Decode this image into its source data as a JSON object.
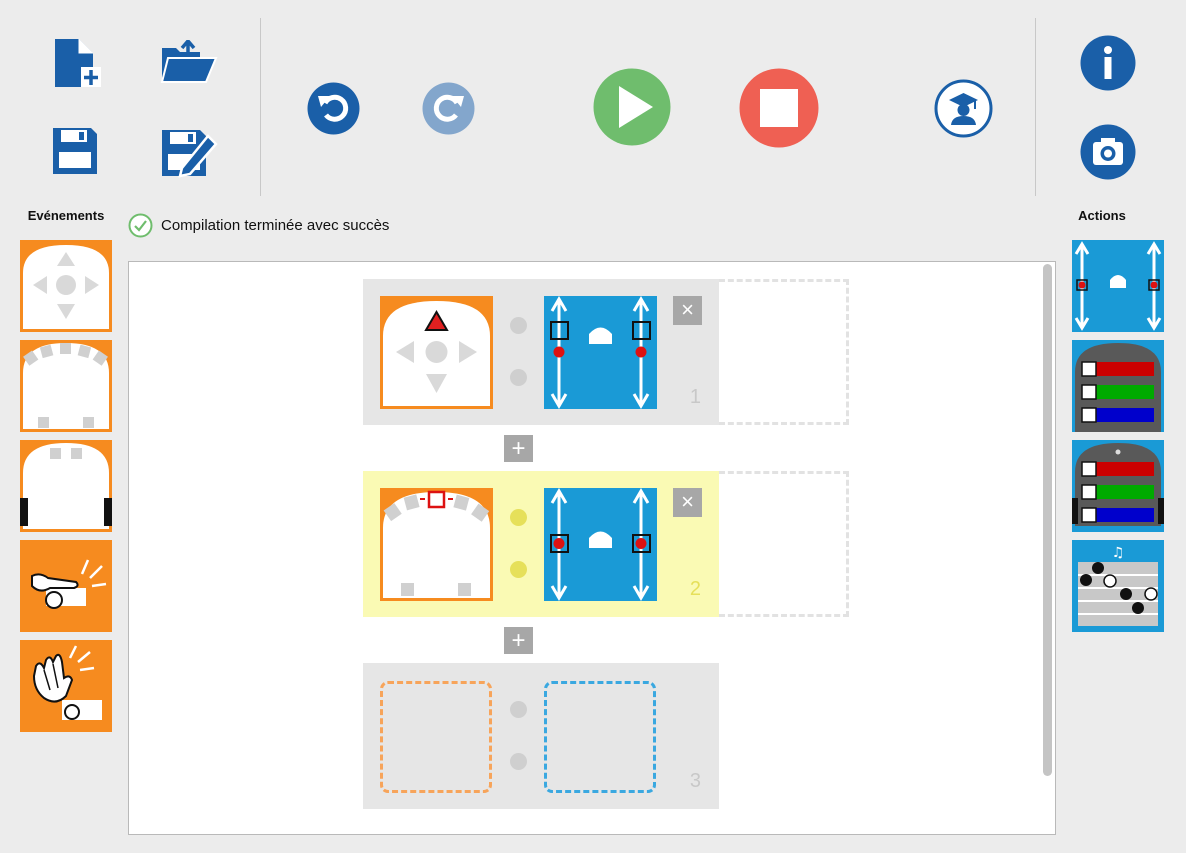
{
  "toolbar": {
    "new": "file-new-icon",
    "open": "folder-open-icon",
    "save": "save-icon",
    "save_as": "save-as-icon",
    "undo": "undo-icon",
    "redo": "redo-icon",
    "run": "play-icon",
    "stop": "stop-icon",
    "advanced": "graduate-icon",
    "info": "info-icon",
    "screenshot": "camera-icon"
  },
  "colors": {
    "brand_blue": "#1a5fa8",
    "redo_blue": "#83a6cc",
    "play_green": "#6fbd6d",
    "stop_red": "#ef6053",
    "event_orange": "#f68b1f",
    "action_blue": "#1a9ad6",
    "pair_yellow": "#fafab4"
  },
  "left_panel": {
    "title": "Evénements",
    "tiles": [
      "buttons-event",
      "prox-horizontal-event",
      "prox-ground-event",
      "tap-event",
      "clap-event"
    ]
  },
  "right_panel": {
    "title": "Actions",
    "tiles": [
      "motors-action",
      "top-color-action",
      "bottom-color-action",
      "music-action"
    ]
  },
  "status": {
    "text": "Compilation terminée avec succès",
    "state": "success"
  },
  "pairs": [
    {
      "number": "1",
      "event": "buttons",
      "action": "motors",
      "highlighted": false
    },
    {
      "number": "2",
      "event": "prox-horizontal",
      "action": "motors",
      "highlighted": true
    },
    {
      "number": "3",
      "event": "empty",
      "action": "empty",
      "highlighted": false
    }
  ],
  "controls": {
    "close": "×",
    "add": "+"
  }
}
